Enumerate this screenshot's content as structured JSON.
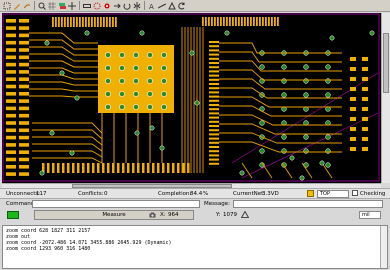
{
  "toolbar": {
    "icons": [
      "select-icon",
      "pencil-icon",
      "route-icon",
      "zoom-icon",
      "grid-icon",
      "layers-icon",
      "pan-icon",
      "measure-icon",
      "cut-icon",
      "via-icon",
      "flip-icon",
      "rotate-icon",
      "mirror-icon",
      "text-icon",
      "ruler-icon",
      "drc-icon",
      "undo-icon"
    ]
  },
  "colors": {
    "board_bg": "#000000",
    "trace": "#e8a000",
    "pad": "#f0b000",
    "via": "#2a8a2a",
    "outline": "#b000b0",
    "green_button": "#1db41d"
  },
  "status": {
    "unconnects_label": "Unconnects:",
    "unconnects_value": "117",
    "conflicts_label": "Conflicts:",
    "conflicts_value": "0",
    "completion_label": "Completion:",
    "completion_value": "84.4",
    "completion_unit": "%",
    "current_net_label": "CurrentNet:",
    "current_net_value": "3.3VD",
    "layer_value": "TOP",
    "checking_label": "Checking"
  },
  "command": {
    "label": "Command:",
    "value": "",
    "message_label": "Message:",
    "message_value": ""
  },
  "measure": {
    "button_label": "Measure",
    "x_label": "X:",
    "x_value": "964",
    "y_label": "Y:",
    "y_value": "1079",
    "unit_value": "mil"
  },
  "console": {
    "lines": [
      "zoom coord 628 1827 311 2157",
      "zoom out",
      "zoom coord -2072.486 14.071 3455.886 2645.929 (Dynamic)",
      "zoom coord 1293 960 316 1480"
    ]
  }
}
